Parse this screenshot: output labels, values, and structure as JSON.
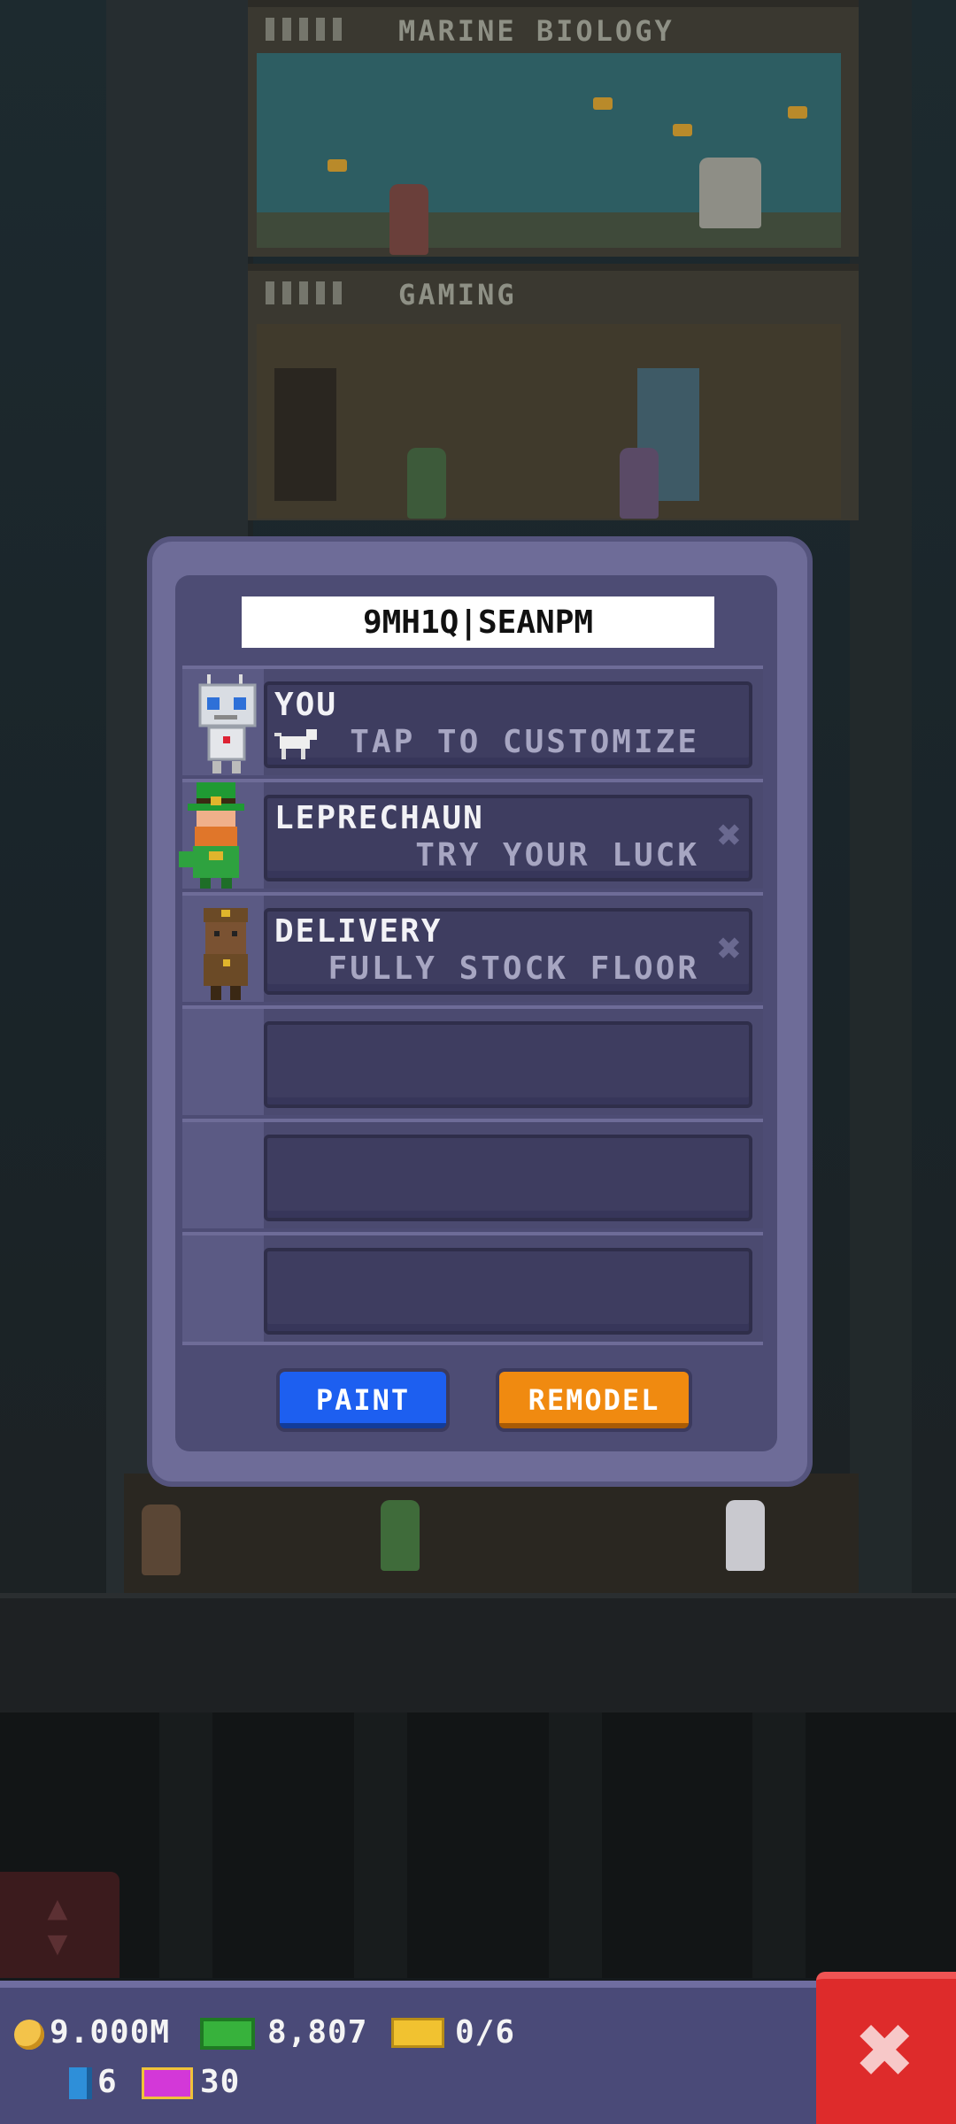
{
  "background": {
    "floors": [
      {
        "name": "MARINE BIOLOGY"
      },
      {
        "name": "GAMING"
      }
    ]
  },
  "dialog": {
    "tower_name": "9MH1Q|SEANPM",
    "slots": [
      {
        "title": "YOU",
        "subtitle": "TAP TO CUSTOMIZE",
        "avatar": "robot-bitizen-icon",
        "removable": false
      },
      {
        "title": "LEPRECHAUN",
        "subtitle": "TRY YOUR LUCK",
        "avatar": "leprechaun-icon",
        "removable": true
      },
      {
        "title": "DELIVERY",
        "subtitle": "FULLY STOCK FLOOR",
        "avatar": "delivery-bitizen-icon",
        "removable": true
      },
      {
        "title": "",
        "subtitle": ""
      },
      {
        "title": "",
        "subtitle": ""
      },
      {
        "title": "",
        "subtitle": ""
      }
    ],
    "remove_glyph": "✖",
    "paint_label": "PAINT",
    "remodel_label": "REMODEL"
  },
  "hud": {
    "coins": "9.000M",
    "tower_bux": "8,807",
    "tickets": "0/6",
    "gems": "6",
    "tv_count": "30",
    "close_glyph": "✖"
  },
  "colors": {
    "paint_button": "#1d5ff0",
    "remodel_button": "#f08a10",
    "close_button": "#de2b2b",
    "dialog_frame": "#6e6c98"
  }
}
